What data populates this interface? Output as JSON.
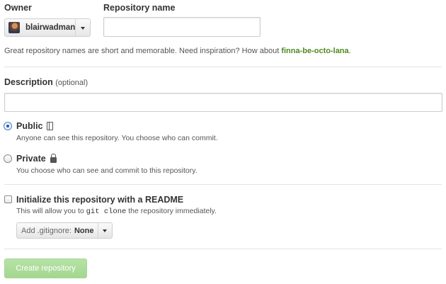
{
  "owner": {
    "label": "Owner",
    "selected": "blairwadman"
  },
  "repository": {
    "label": "Repository name",
    "value": "",
    "placeholder": ""
  },
  "hint": {
    "text": "Great repository names are short and memorable. Need inspiration? How about ",
    "suggestion": "finna-be-octo-lana",
    "end": "."
  },
  "description": {
    "label": "Description",
    "optional": "(optional)",
    "value": "",
    "placeholder": ""
  },
  "visibility": {
    "selected": "public",
    "public": {
      "title": "Public",
      "desc": "Anyone can see this repository. You choose who can commit."
    },
    "private": {
      "title": "Private",
      "desc": "You choose who can see and commit to this repository."
    }
  },
  "init": {
    "title": "Initialize this repository with a README",
    "desc_before": "This will allow you to ",
    "desc_code": "git clone",
    "desc_after": " the repository immediately."
  },
  "gitignore": {
    "prefix": "Add .gitignore:",
    "value": "None"
  },
  "submit": {
    "label": "Create repository"
  },
  "colors": {
    "suggestion": "#4e8a1e",
    "create_button": "#a3d690",
    "radio_selected": "#2a5a9e"
  },
  "icons": {
    "public": "repo-book-icon",
    "private": "lock-icon"
  }
}
